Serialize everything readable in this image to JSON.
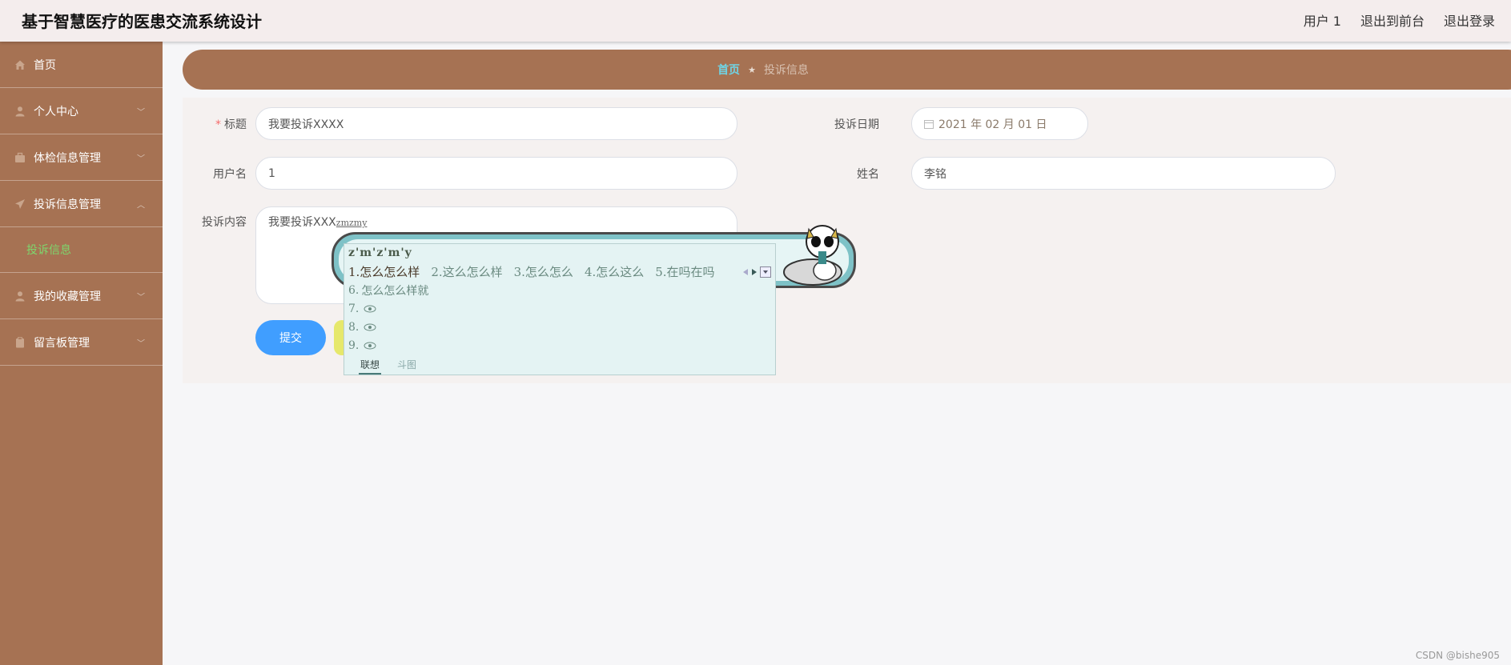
{
  "header": {
    "title": "基于智慧医疗的医患交流系统设计",
    "links": [
      "用户 1",
      "退出到前台",
      "退出登录"
    ]
  },
  "sidebar": {
    "items": [
      {
        "label": "首页",
        "icon": "home-icon"
      },
      {
        "label": "个人中心",
        "icon": "user-icon"
      },
      {
        "label": "体检信息管理",
        "icon": "briefcase-icon"
      },
      {
        "label": "投诉信息管理",
        "icon": "send-icon"
      },
      {
        "label": "我的收藏管理",
        "icon": "user-icon"
      },
      {
        "label": "留言板管理",
        "icon": "clipboard-icon"
      }
    ],
    "submenu_active": "投诉信息"
  },
  "breadcrumb": {
    "home": "首页",
    "separator": "★",
    "current": "投诉信息"
  },
  "form": {
    "title_label": "标题",
    "required_mark": "*",
    "title_value": "我要投诉XXXX",
    "date_label": "投诉日期",
    "date_value": "2021 年 02 月 01 日",
    "username_label": "用户名",
    "username_value": "1",
    "name_label": "姓名",
    "name_value": "李铭",
    "content_label": "投诉内容",
    "content_value": "我要投诉XXX",
    "content_composing": "zmzmy",
    "submit_label": "提交"
  },
  "ime": {
    "pinyin": "z'm'z'm'y",
    "candidates": [
      "1.怎么怎么样",
      "2.这么怎么样",
      "3.怎么怎么",
      "4.怎么这么",
      "5.在吗在吗"
    ],
    "more": [
      {
        "num": "6.",
        "text": "怎么怎么样就"
      },
      {
        "num": "7.",
        "text": ""
      },
      {
        "num": "8.",
        "text": ""
      },
      {
        "num": "9.",
        "text": ""
      }
    ],
    "tabs": [
      "联想",
      "斗图"
    ]
  },
  "watermark": "CSDN @bishe905",
  "colors": {
    "sidebar": "#a67253",
    "accent": "#409eff",
    "active_submenu": "#7ed66d",
    "crumb_home": "#6fd4e6"
  }
}
